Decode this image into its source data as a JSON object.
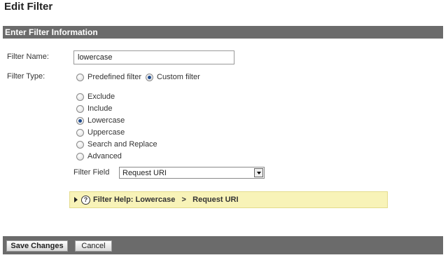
{
  "page": {
    "title": "Edit Filter"
  },
  "section": {
    "header": "Enter Filter Information"
  },
  "filter_name": {
    "label": "Filter Name:",
    "value": "lowercase"
  },
  "filter_type": {
    "label": "Filter Type:",
    "options": [
      {
        "label": "Predefined filter",
        "checked": false
      },
      {
        "label": "Custom filter",
        "checked": true
      }
    ]
  },
  "custom_options": [
    {
      "label": "Exclude",
      "checked": false
    },
    {
      "label": "Include",
      "checked": false
    },
    {
      "label": "Lowercase",
      "checked": true
    },
    {
      "label": "Uppercase",
      "checked": false
    },
    {
      "label": "Search and Replace",
      "checked": false
    },
    {
      "label": "Advanced",
      "checked": false
    }
  ],
  "filter_field": {
    "label": "Filter Field",
    "selected": "Request URI"
  },
  "help": {
    "text": "Filter Help: Lowercase   >   Request URI",
    "icon": "question-icon"
  },
  "footer": {
    "save_label": "Save Changes",
    "cancel_label": "Cancel"
  }
}
